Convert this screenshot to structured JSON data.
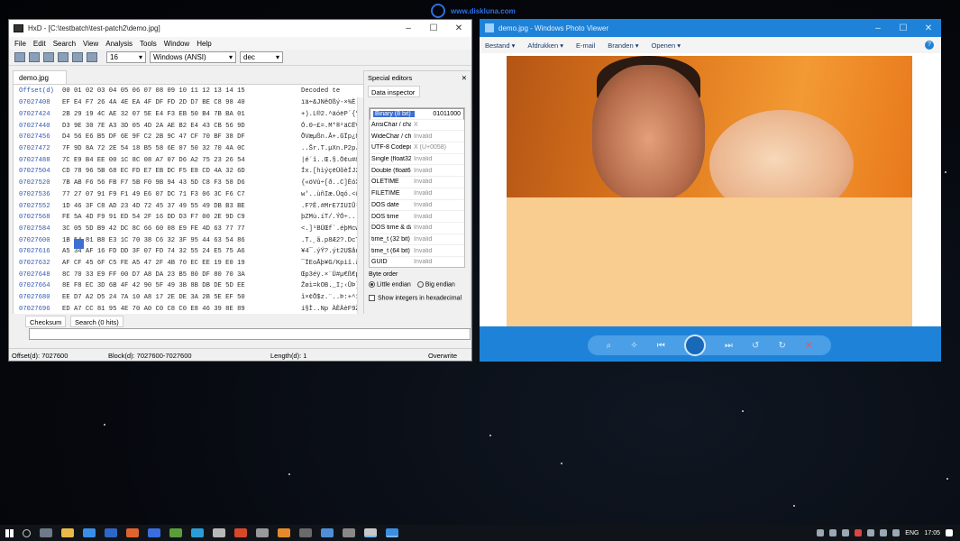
{
  "watermark": {
    "text": "www.diskluna.com"
  },
  "hxd": {
    "title": "HxD - [C:\\testbatch\\test-patch2\\demo.jpg]",
    "menu": [
      "File",
      "Edit",
      "Search",
      "View",
      "Analysis",
      "Tools",
      "Window",
      "Help"
    ],
    "bytes_per_row": "16",
    "charset": "Windows (ANSI)",
    "offset_base": "dec",
    "doc_tab": "demo.jpg",
    "hex_header_offset": "Offset(d)",
    "hex_header_columns": "00 01 02 03 04 05 06 07 08 09 10 11 12 13 14 15",
    "hex_header_decoded": "Decoded te",
    "rows": [
      {
        "off": "07027408",
        "bytes": "EF E4 F7 26 4A 4E EA 4F DF FD 2D D7 BE C8 98 40",
        "dec": "ïä÷&JNêOßý-×¾È.@"
      },
      {
        "off": "07027424",
        "bytes": "2B 29 19 4C AE 32 07 5E E4 F3 EB 50 B4 7B BA 01",
        "dec": "+).L®2.^äóëP´{º."
      },
      {
        "off": "07027440",
        "bytes": "D3 9E 30 7E A3 3D 05 4D 2A AE B2 E4 43 CB 56 9D",
        "dec": "Ó.0~£=.M*®²äCËV."
      },
      {
        "off": "07027456",
        "bytes": "D4 56 E6 B5 DF 6E 9F C2 2B 9C 47 CF 70 BF 38 DF",
        "dec": "ÔVæµßn.Â+.GÏp¿8ß"
      },
      {
        "off": "07027472",
        "bytes": "7F 9D 8A 72 2E 54 18 B5 58 6E 07 50 32 70 4A 0C",
        "dec": "..Šr.T.µXn.P2pJ."
      },
      {
        "off": "07027488",
        "bytes": "7C E9 B4 EE 00 1C 8C 08 A7 07 D6 A2 75 23 26 54",
        "dec": "|é´î..Œ.§.Ö¢u#&T"
      },
      {
        "off": "07027504",
        "bytes": "CD 78 96 5B 68 EC FD E7 EB DC F5 E8 CD 4A 32 6D",
        "dec": "Íx.[hìýçëÜõèÍJ2m"
      },
      {
        "off": "07027520",
        "bytes": "7B AB F6 56 FB F7 5B F0 9B 94 43 5D C8 F3 58 D6",
        "dec": "{«öVû÷[ð..C]ÈóXÖ"
      },
      {
        "off": "07027536",
        "bytes": "77 27 07 91 F9 F1 49 E6 07 DC 71 F3 06 3C F6 C7",
        "dec": "w'..ùñIæ.Üqó.<öÇ"
      },
      {
        "off": "07027552",
        "bytes": "1D 46 3F C8 AD 23 4D 72 45 37 49 55 49 DB B3 BE",
        "dec": ".F?È.#MrE7IUIÛ³¾"
      },
      {
        "off": "07027568",
        "bytes": "FE 5A 4D F9 91 ED 54 2F 16 DD D3 F7 00 2E 9D C9",
        "dec": "þZMù.íT/.ÝÓ÷...É"
      },
      {
        "off": "07027584",
        "bytes": "3C 05 5D B9 42 DC 8C 66 60 08 E9 FE 4D 63 77 77",
        "dec": "<.]¹BÜŒf`.éþMcww"
      },
      {
        "off": "07027600",
        "bytes": "1B 54 81 B8 E3 1C 70 38 C6 32 3F 95 44 63 54 86",
        "dec": ".T.¸ã.p8Æ2?.DcT."
      },
      {
        "off": "07027616",
        "bytes": "A5 34 AF 16 FD DD 3F 07 FD 74 32 55 24 E5 75 A6",
        "dec": "¥4¯.ýÝ?.ýt2U$åu¦"
      },
      {
        "off": "07027632",
        "bytes": "AF CF 45 6F C5 FE A5 47 2F 4B 70 EC EE 19 E0 19",
        "dec": "¯ÏEoÅþ¥G/Kpìî.à."
      },
      {
        "off": "07027648",
        "bytes": "8C 70 33 E9 FF 00 D7 A8 DA 23 B5 80 DF 80 70 3A",
        "dec": "Œp3éÿ.×¨Ú#µ€ß€p:"
      },
      {
        "off": "07027664",
        "bytes": "8E F8 EC 3D 6B 4F 42 90 5F 49 3B 8B DB DE 5D EE",
        "dec": "Žøì=kOB._I;‹ÛÞ]î"
      },
      {
        "off": "07027680",
        "bytes": "EE D7 A2 D5 24 7A 10 A8 17 2E DE 3A 2B 5E EF 50",
        "dec": "î×¢Õ$z.¨..Þ:+^ïP"
      },
      {
        "off": "07027696",
        "bytes": "ED A7 CC 81 95 4E 70 A0 C0 C8 C0 E8 46 39 8E 89",
        "dec": "í§Ì..Np ÀÈÀèF9Ž‰"
      },
      {
        "off": "07027712",
        "bytes": "F4 A8 56 12 D8 C8 E2 0F 4F BB DB A6 07 A0 47 4A",
        "dec": "ô¨V.ØÈâ.O»Û¦. GJ"
      }
    ],
    "special_editors_title": "Special editors",
    "data_inspector_tab": "Data inspector",
    "inspector": [
      {
        "k": "Binary (8 bit)",
        "v": "01011000",
        "selected": true
      },
      {
        "k": "AnsiChar / char8_t",
        "v": "X",
        "selected": false
      },
      {
        "k": "WideChar / char16_t",
        "v": "Invalid",
        "selected": false
      },
      {
        "k": "UTF-8 Codepoint",
        "v": "X (U+0058)",
        "selected": false
      },
      {
        "k": "Single (float32)",
        "v": "Invalid",
        "selected": false
      },
      {
        "k": "Double (float64)",
        "v": "Invalid",
        "selected": false
      },
      {
        "k": "OLETIME",
        "v": "Invalid",
        "selected": false
      },
      {
        "k": "FILETIME",
        "v": "Invalid",
        "selected": false
      },
      {
        "k": "DOS date",
        "v": "Invalid",
        "selected": false
      },
      {
        "k": "DOS time",
        "v": "Invalid",
        "selected": false
      },
      {
        "k": "DOS time & date",
        "v": "Invalid",
        "selected": false
      },
      {
        "k": "time_t (32 bit)",
        "v": "Invalid",
        "selected": false
      },
      {
        "k": "time_t (64 bit)",
        "v": "Invalid",
        "selected": false
      },
      {
        "k": "GUID",
        "v": "Invalid",
        "selected": false
      }
    ],
    "byte_order_label": "Byte order",
    "little_endian": "Little endian",
    "big_endian": "Big endian",
    "show_hex": "Show integers in hexadecimal",
    "tab_checksum": "Checksum",
    "tab_search": "Search (0 hits)",
    "status_offset": "Offset(d): 7027600",
    "status_block": "Block(d): 7027600-7027600",
    "status_length": "Length(d): 1",
    "status_mode": "Overwrite"
  },
  "viewer": {
    "title": "demo.jpg - Windows Photo Viewer",
    "menu": [
      "Bestand ▾",
      "Afdrukken ▾",
      "E-mail",
      "Branden ▾",
      "Openen ▾"
    ],
    "help": "?"
  },
  "taskbar": {
    "lang": "ENG",
    "time": "17:05"
  }
}
